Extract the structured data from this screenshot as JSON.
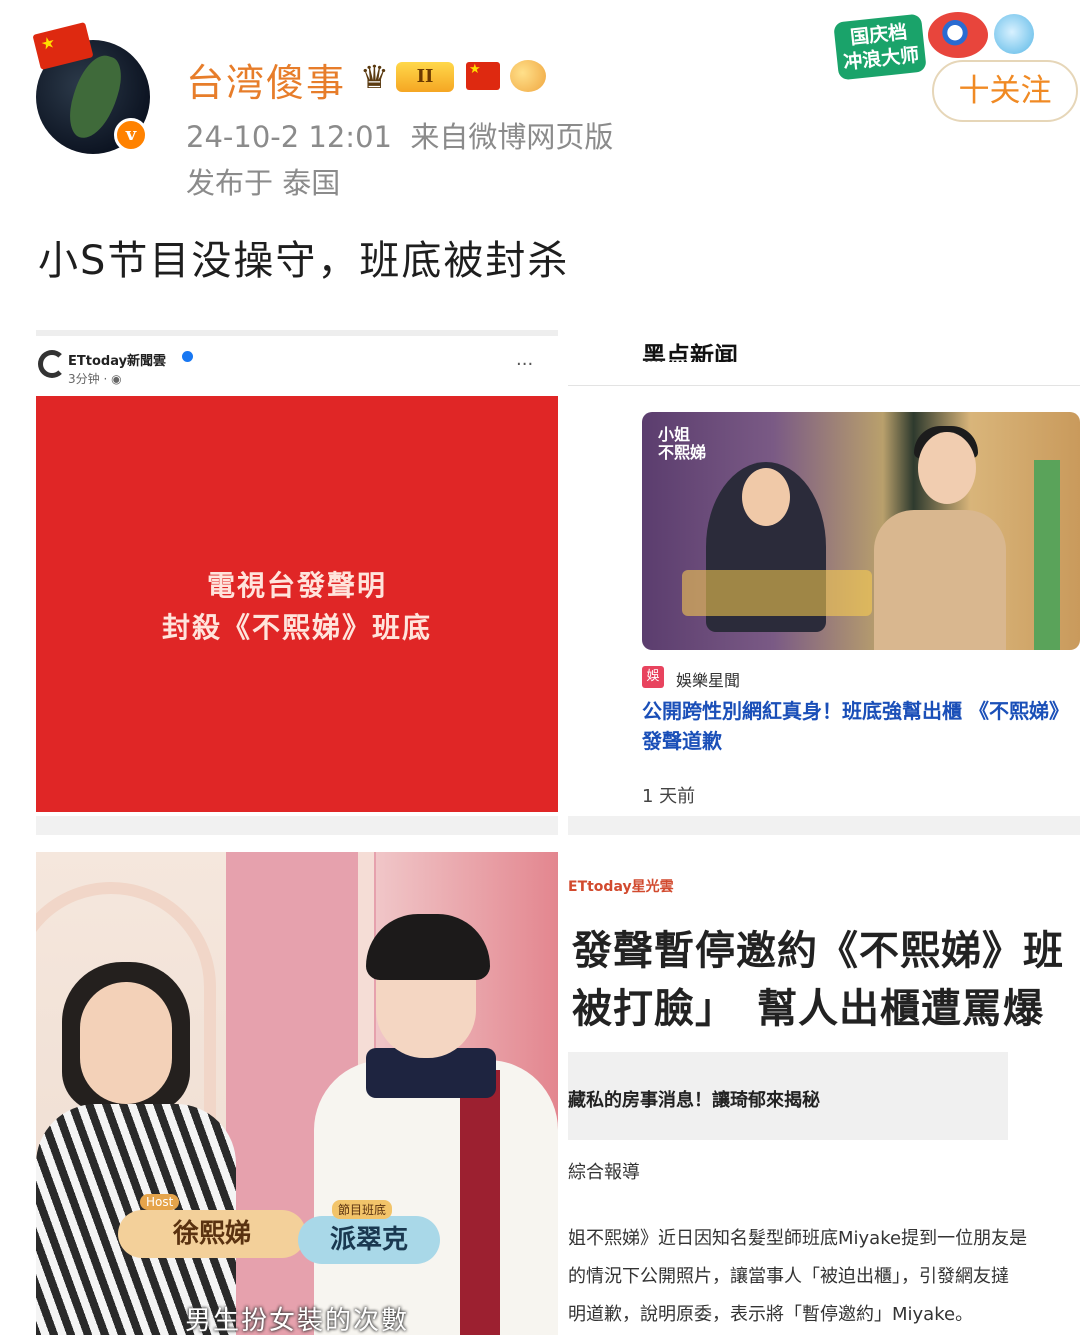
{
  "post": {
    "username": "台湾傻事",
    "level_badge": "II",
    "timestamp": "24-10-2 12:01",
    "source": "来自微博网页版",
    "location": "发布于 泰国",
    "follow_label": "十关注",
    "promo_label": "国庆档\n冲浪大师",
    "verified_mark": "v",
    "text": "小S节目没操守，班底被封杀"
  },
  "images": {
    "c1": {
      "page_name": "ETtoday新聞雲",
      "time": "3分钟 · ",
      "more": "···",
      "headline_line1": "電視台發聲明",
      "headline_line2": "封殺《不熙娣》班底"
    },
    "c2": {
      "cut_header": "黑点新闻",
      "thumb_logo": "小姐\n不熙娣",
      "category_tag": "娛",
      "category": "娛樂星聞",
      "title": "公開跨性別網紅真身！班底強幫出櫃 《不熙娣》發聲道歉",
      "age": "1 天前"
    },
    "c3": {
      "host_tag": "Host",
      "host_name": "徐熙娣",
      "guest_tag": "節目班底",
      "guest_name": "派翠克",
      "subtitle": "男生扮女裝的次數"
    },
    "c4": {
      "source": "ETtoday星光雲",
      "headline_line1": "發聲暫停邀約《不熙娣》班",
      "headline_line2": "被打臉」　幫人出櫃遭罵爆",
      "box_text": "藏私的房事消息！讓琦郁來揭秘",
      "report": "綜合報導",
      "para1": "姐不熙娣》近日因知名髮型師班底Miyake提到一位朋友是",
      "para2": "的情況下公開照片，讓當事人「被迫出櫃」，引發網友撻",
      "para3": "明道歉，說明原委，表示將「暫停邀約」Miyake。"
    }
  }
}
